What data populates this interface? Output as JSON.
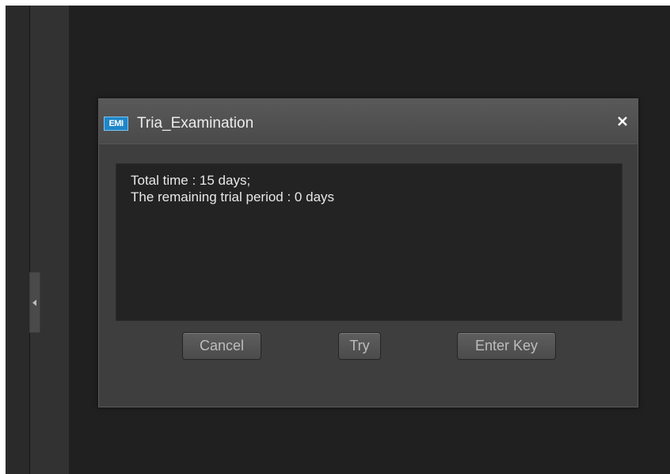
{
  "dialog": {
    "title": "Tria_Examination",
    "icon_label": "EMI",
    "icon_color": "#1f86c8",
    "close_icon": "close-icon",
    "message_lines": [
      "Total time : 15 days;",
      "The remaining trial period : 0 days"
    ],
    "buttons": {
      "cancel": "Cancel",
      "try": "Try",
      "enter_key": "Enter Key"
    }
  },
  "background": {
    "collapse_handle_icon": "chevron-left-icon"
  }
}
